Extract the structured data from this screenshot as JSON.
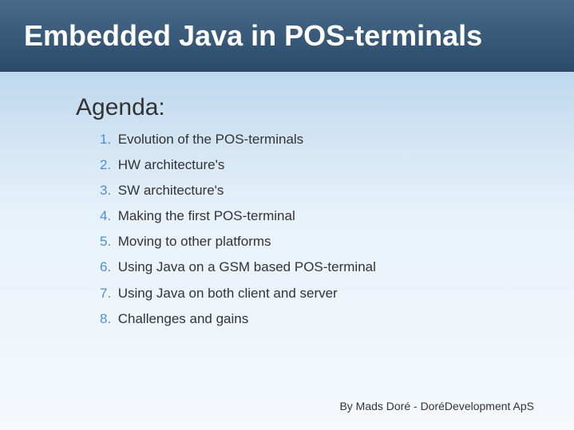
{
  "title": "Embedded Java in POS-terminals",
  "heading": "Agenda:",
  "items": [
    {
      "num": "1.",
      "text": "Evolution of the POS-terminals"
    },
    {
      "num": "2.",
      "text": "HW architecture's"
    },
    {
      "num": "3.",
      "text": "SW architecture's"
    },
    {
      "num": "4.",
      "text": "Making the first POS-terminal"
    },
    {
      "num": "5.",
      "text": "Moving to other platforms"
    },
    {
      "num": "6.",
      "text": "Using Java on a GSM based POS-terminal"
    },
    {
      "num": "7.",
      "text": "Using Java on both client and server"
    },
    {
      "num": "8.",
      "text": "Challenges and gains"
    }
  ],
  "footer": "By Mads Doré - DoréDevelopment ApS"
}
